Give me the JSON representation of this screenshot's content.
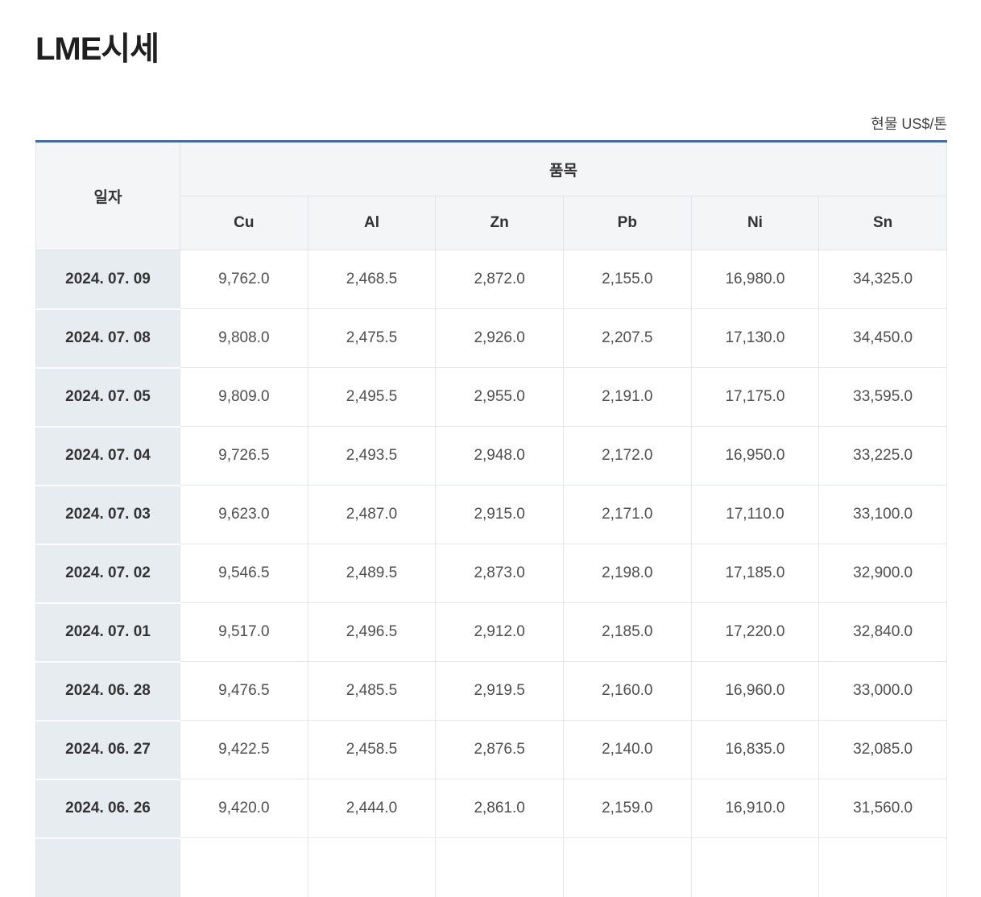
{
  "page": {
    "title": "LME시세",
    "unit_label": "현물 US$/톤"
  },
  "table": {
    "date_header": "일자",
    "group_header": "품목",
    "metal_headers": [
      "Cu",
      "Al",
      "Zn",
      "Pb",
      "Ni",
      "Sn"
    ],
    "rows": [
      {
        "date": "2024. 07. 09",
        "values": [
          "9,762.0",
          "2,468.5",
          "2,872.0",
          "2,155.0",
          "16,980.0",
          "34,325.0"
        ]
      },
      {
        "date": "2024. 07. 08",
        "values": [
          "9,808.0",
          "2,475.5",
          "2,926.0",
          "2,207.5",
          "17,130.0",
          "34,450.0"
        ]
      },
      {
        "date": "2024. 07. 05",
        "values": [
          "9,809.0",
          "2,495.5",
          "2,955.0",
          "2,191.0",
          "17,175.0",
          "33,595.0"
        ]
      },
      {
        "date": "2024. 07. 04",
        "values": [
          "9,726.5",
          "2,493.5",
          "2,948.0",
          "2,172.0",
          "16,950.0",
          "33,225.0"
        ]
      },
      {
        "date": "2024. 07. 03",
        "values": [
          "9,623.0",
          "2,487.0",
          "2,915.0",
          "2,171.0",
          "17,110.0",
          "33,100.0"
        ]
      },
      {
        "date": "2024. 07. 02",
        "values": [
          "9,546.5",
          "2,489.5",
          "2,873.0",
          "2,198.0",
          "17,185.0",
          "32,900.0"
        ]
      },
      {
        "date": "2024. 07. 01",
        "values": [
          "9,517.0",
          "2,496.5",
          "2,912.0",
          "2,185.0",
          "17,220.0",
          "32,840.0"
        ]
      },
      {
        "date": "2024. 06. 28",
        "values": [
          "9,476.5",
          "2,485.5",
          "2,919.5",
          "2,160.0",
          "16,960.0",
          "33,000.0"
        ]
      },
      {
        "date": "2024. 06. 27",
        "values": [
          "9,422.5",
          "2,458.5",
          "2,876.5",
          "2,140.0",
          "16,835.0",
          "32,085.0"
        ]
      },
      {
        "date": "2024. 06. 26",
        "values": [
          "9,420.0",
          "2,444.0",
          "2,861.0",
          "2,159.0",
          "16,910.0",
          "31,560.0"
        ]
      }
    ]
  },
  "colors": {
    "accent_top_border": "#4769a4",
    "header_bg": "#f4f5f7",
    "date_cell_bg": "#e7ecf1",
    "border": "#e2e3e6"
  }
}
